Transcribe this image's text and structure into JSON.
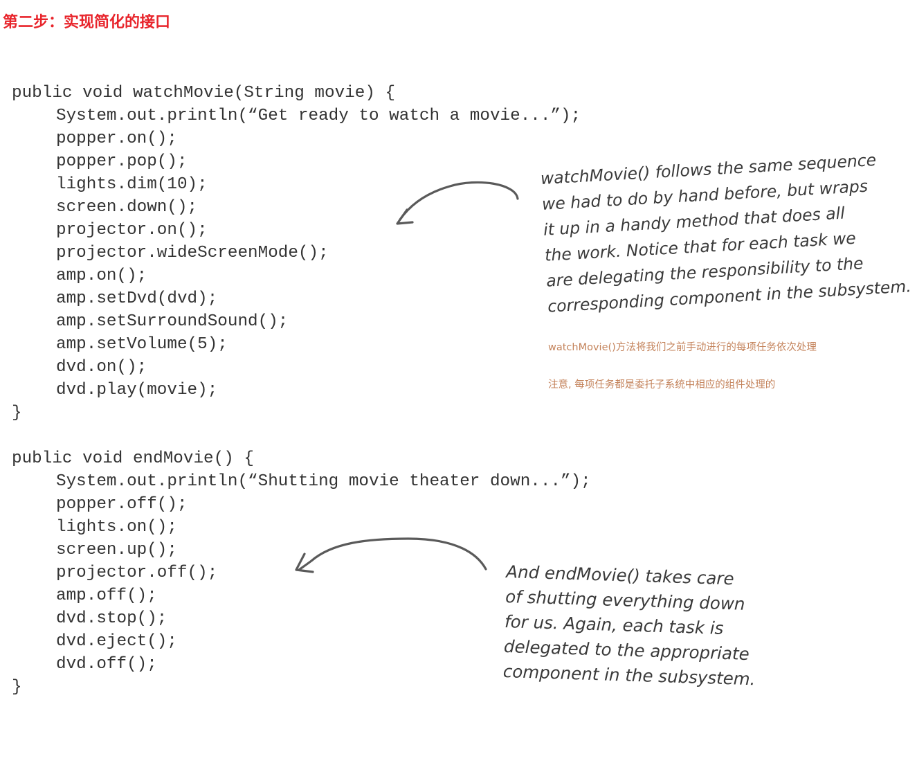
{
  "heading": "第二步：实现简化的接口",
  "code_watch": [
    {
      "text": "public void watchMovie(String movie) {",
      "indent": false
    },
    {
      "text": "System.out.println(“Get ready to watch a movie...”);",
      "indent": true
    },
    {
      "text": "popper.on();",
      "indent": true
    },
    {
      "text": "popper.pop();",
      "indent": true
    },
    {
      "text": "lights.dim(10);",
      "indent": true
    },
    {
      "text": "screen.down();",
      "indent": true
    },
    {
      "text": "projector.on();",
      "indent": true
    },
    {
      "text": "projector.wideScreenMode();",
      "indent": true
    },
    {
      "text": "amp.on();",
      "indent": true
    },
    {
      "text": "amp.setDvd(dvd);",
      "indent": true
    },
    {
      "text": "amp.setSurroundSound();",
      "indent": true
    },
    {
      "text": "amp.setVolume(5);",
      "indent": true
    },
    {
      "text": "dvd.on();",
      "indent": true
    },
    {
      "text": "dvd.play(movie);",
      "indent": true
    },
    {
      "text": "}",
      "indent": false
    }
  ],
  "code_end": [
    {
      "text": "public void endMovie() {",
      "indent": false
    },
    {
      "text": "System.out.println(“Shutting movie theater down...”);",
      "indent": true
    },
    {
      "text": "popper.off();",
      "indent": true
    },
    {
      "text": "lights.on();",
      "indent": true
    },
    {
      "text": "screen.up();",
      "indent": true
    },
    {
      "text": "projector.off();",
      "indent": true
    },
    {
      "text": "amp.off();",
      "indent": true
    },
    {
      "text": "dvd.stop();",
      "indent": true
    },
    {
      "text": "dvd.eject();",
      "indent": true
    },
    {
      "text": "dvd.off();",
      "indent": true
    },
    {
      "text": "}",
      "indent": false
    }
  ],
  "note_watch": [
    "watchMovie() follows the same sequence",
    "we had to do by hand before, but wraps",
    "it up in a handy method that does all",
    "the work.  Notice that for each task we",
    "are delegating the responsibility to the",
    "corresponding component in the subsystem."
  ],
  "note_watch_cn_1": "watchMovie()方法将我们之前手动进行的每项任务依次处理",
  "note_watch_cn_2": "注意, 每项任务都是委托子系统中相应的组件处理的",
  "note_end": [
    "And endMovie() takes care",
    "of shutting everything down",
    "for us.  Again, each task is",
    "delegated to the appropriate",
    "component in the subsystem."
  ],
  "colors": {
    "heading": "#e8242b",
    "code": "#333333",
    "handwriting": "#3a3a3a",
    "chinese_note": "#c4835b",
    "arrow": "#5a5a5a"
  }
}
